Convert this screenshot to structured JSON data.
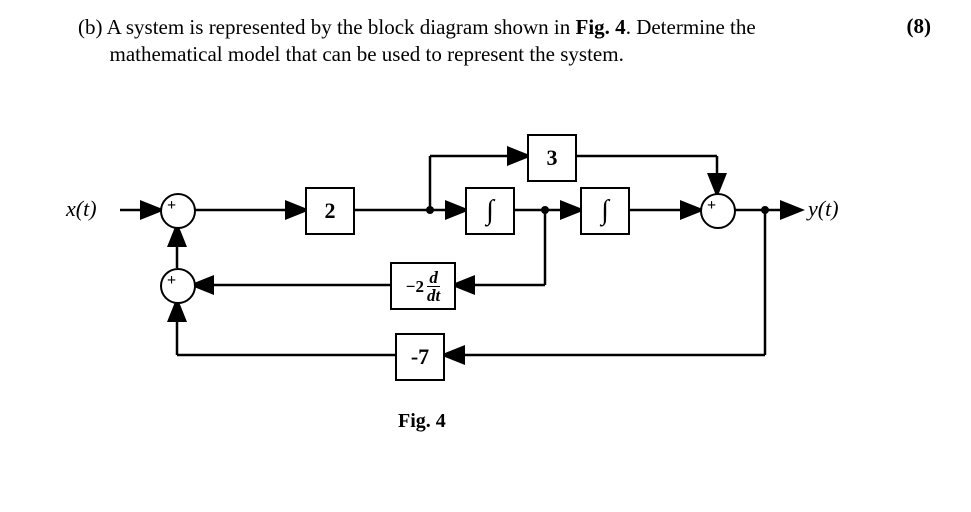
{
  "question": {
    "part_label": "(b)",
    "text_line1": "A system is represented by the block diagram shown in ",
    "fig_ref": "Fig. 4",
    "text_line1_end": ". Determine the",
    "text_line2": "mathematical model that can be used to represent the system.",
    "marks": "(8)"
  },
  "diagram": {
    "input_label": "x(t)",
    "output_label": "y(t)",
    "block_gain2": "2",
    "block_gain3": "3",
    "block_int1": "∫",
    "block_int2": "∫",
    "block_deriv_prefix": "−2",
    "block_deriv_num": "d",
    "block_deriv_den": "dt",
    "block_gainm7": "-7",
    "sum_sign": "+",
    "fig_label": "Fig. 4"
  }
}
